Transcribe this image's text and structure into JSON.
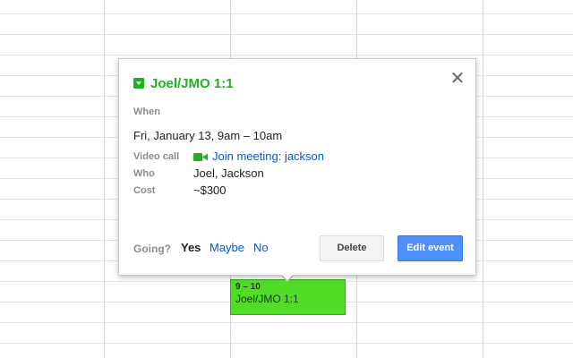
{
  "calendar": {
    "event": {
      "time": "9 – 10",
      "title": "Joel/JMO 1:1",
      "color": "#51dd27"
    }
  },
  "popup": {
    "icon": "calendar-dropdown-icon",
    "title": "Joel/JMO 1:1",
    "title_color": "#1eb31e",
    "close_icon": "close-icon",
    "when_label": "When",
    "when_value": "Fri, January 13, 9am – 10am",
    "video_label": "Video call",
    "video_icon": "video-camera-icon",
    "video_link": "Join meeting: jackson",
    "who_label": "Who",
    "who_value": "Joel, Jackson",
    "cost_label": "Cost",
    "cost_value": "~$300",
    "going_label": "Going?",
    "rsvp": {
      "yes": "Yes",
      "maybe": "Maybe",
      "no": "No"
    },
    "delete_button": "Delete",
    "edit_button": "Edit event",
    "accent_color": "#4d90fe",
    "link_color": "#1155cc"
  }
}
